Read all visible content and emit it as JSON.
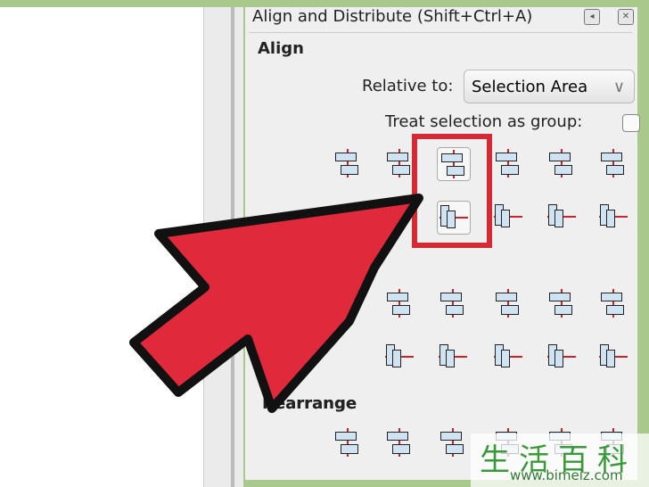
{
  "panel": {
    "title": "Align and Distribute (Shift+Ctrl+A)",
    "title_buttons": [
      "◂",
      "✕"
    ],
    "align_section": "Align",
    "relative_to_label": "Relative to:",
    "relative_to_value": "Selection Area",
    "treat_as_group_label": "Treat selection as group:",
    "treat_as_group_checked": false,
    "rearrange_section": "Rearrange",
    "rearrange_visible_text": "earrange"
  },
  "highlight": {
    "color": "#d42a35",
    "targets": [
      "center-on-vertical-axis",
      "center-on-horizontal-axis"
    ]
  },
  "arrow": {
    "fill": "#e02a3c",
    "stroke": "#111111"
  },
  "watermark": {
    "text": "生活百科",
    "url": "www.bimeiz.com"
  }
}
